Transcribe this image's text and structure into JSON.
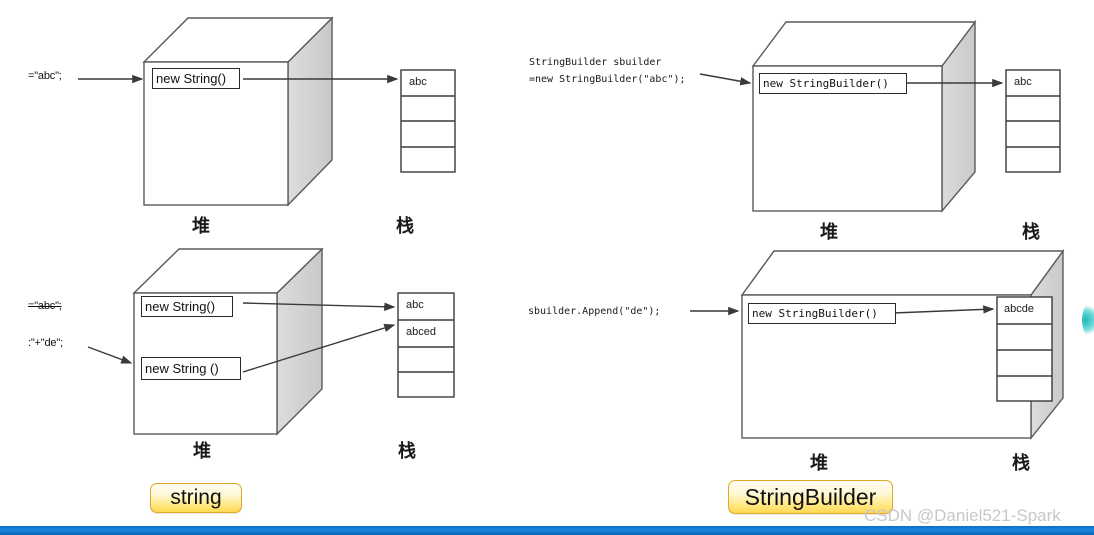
{
  "diagram": {
    "title": "string vs StringBuilder memory model",
    "heap_label": "堆",
    "stack_label": "栈",
    "badge_string": "string",
    "badge_stringbuilder": "StringBuilder",
    "watermark": "CSDN @Daniel521-Spark"
  },
  "panels": [
    {
      "id": "string-initial",
      "side": "left",
      "row": "top",
      "code_lines": [
        "=\"abc\";"
      ],
      "heap_objects": [
        "new String()"
      ],
      "heap_label": "堆",
      "stack_label": "栈",
      "stack_cells": [
        "abc",
        "",
        "",
        ""
      ]
    },
    {
      "id": "string-concat",
      "side": "left",
      "row": "bottom",
      "code_lines": [
        "=\"abc\";",
        ":\"+\"de\";"
      ],
      "heap_objects": [
        "new String()",
        "new  String ()"
      ],
      "heap_label": "堆",
      "stack_label": "栈",
      "stack_cells": [
        "abc",
        "abced",
        "",
        ""
      ]
    },
    {
      "id": "stringbuilder-initial",
      "side": "right",
      "row": "top",
      "code_lines": [
        "StringBuilder sbuilder",
        "=new StringBuilder(\"abc\");"
      ],
      "heap_objects": [
        "new StringBuilder()"
      ],
      "heap_label": "堆",
      "stack_label": "栈",
      "stack_cells": [
        "abc",
        "",
        "",
        ""
      ]
    },
    {
      "id": "stringbuilder-append",
      "side": "right",
      "row": "bottom",
      "code_lines": [
        "sbuilder.Append(\"de\");"
      ],
      "heap_objects": [
        "new StringBuilder()"
      ],
      "heap_label": "堆",
      "stack_label": "栈",
      "stack_cells": [
        "abcde",
        "",
        "",
        ""
      ]
    }
  ],
  "labels": {
    "l_code_1": "=\"abc\";",
    "l_obj_1": "new String()",
    "l_heap_1": "堆",
    "l_stack_1": "栈",
    "l_cell_1_1": "abc",
    "l_code_2a": "=\"abc\";",
    "l_code_2b": ":\"+\"de\";",
    "l_obj_2a": "new String()",
    "l_obj_2b": "new  String ()",
    "l_heap_2": "堆",
    "l_stack_2": "栈",
    "l_cell_2_1": "abc",
    "l_cell_2_2": "abced",
    "r_code_3a": "StringBuilder sbuilder",
    "r_code_3b": "=new StringBuilder(\"abc\");",
    "r_obj_3": "new StringBuilder()",
    "r_heap_3": "堆",
    "r_stack_3": "栈",
    "r_cell_3_1": "abc",
    "r_code_4": "sbuilder.Append(\"de\");",
    "r_obj_4": "new StringBuilder()",
    "r_heap_4": "堆",
    "r_stack_4": "栈",
    "r_cell_4_1": "abcde"
  },
  "colors": {
    "cube_stroke": "#5a5a5a",
    "cube_face": "#ffffff",
    "cube_side": "#d4d4d4",
    "arrow": "#3a3a3a",
    "badge_border": "#e0a92b",
    "badge_fill_top": "#fffdf0",
    "badge_fill_bottom": "#ffd94f",
    "bottom_bar": "#1a86e0",
    "watermark": "#c8c8c8",
    "accent_teal": "#13b3b6"
  }
}
